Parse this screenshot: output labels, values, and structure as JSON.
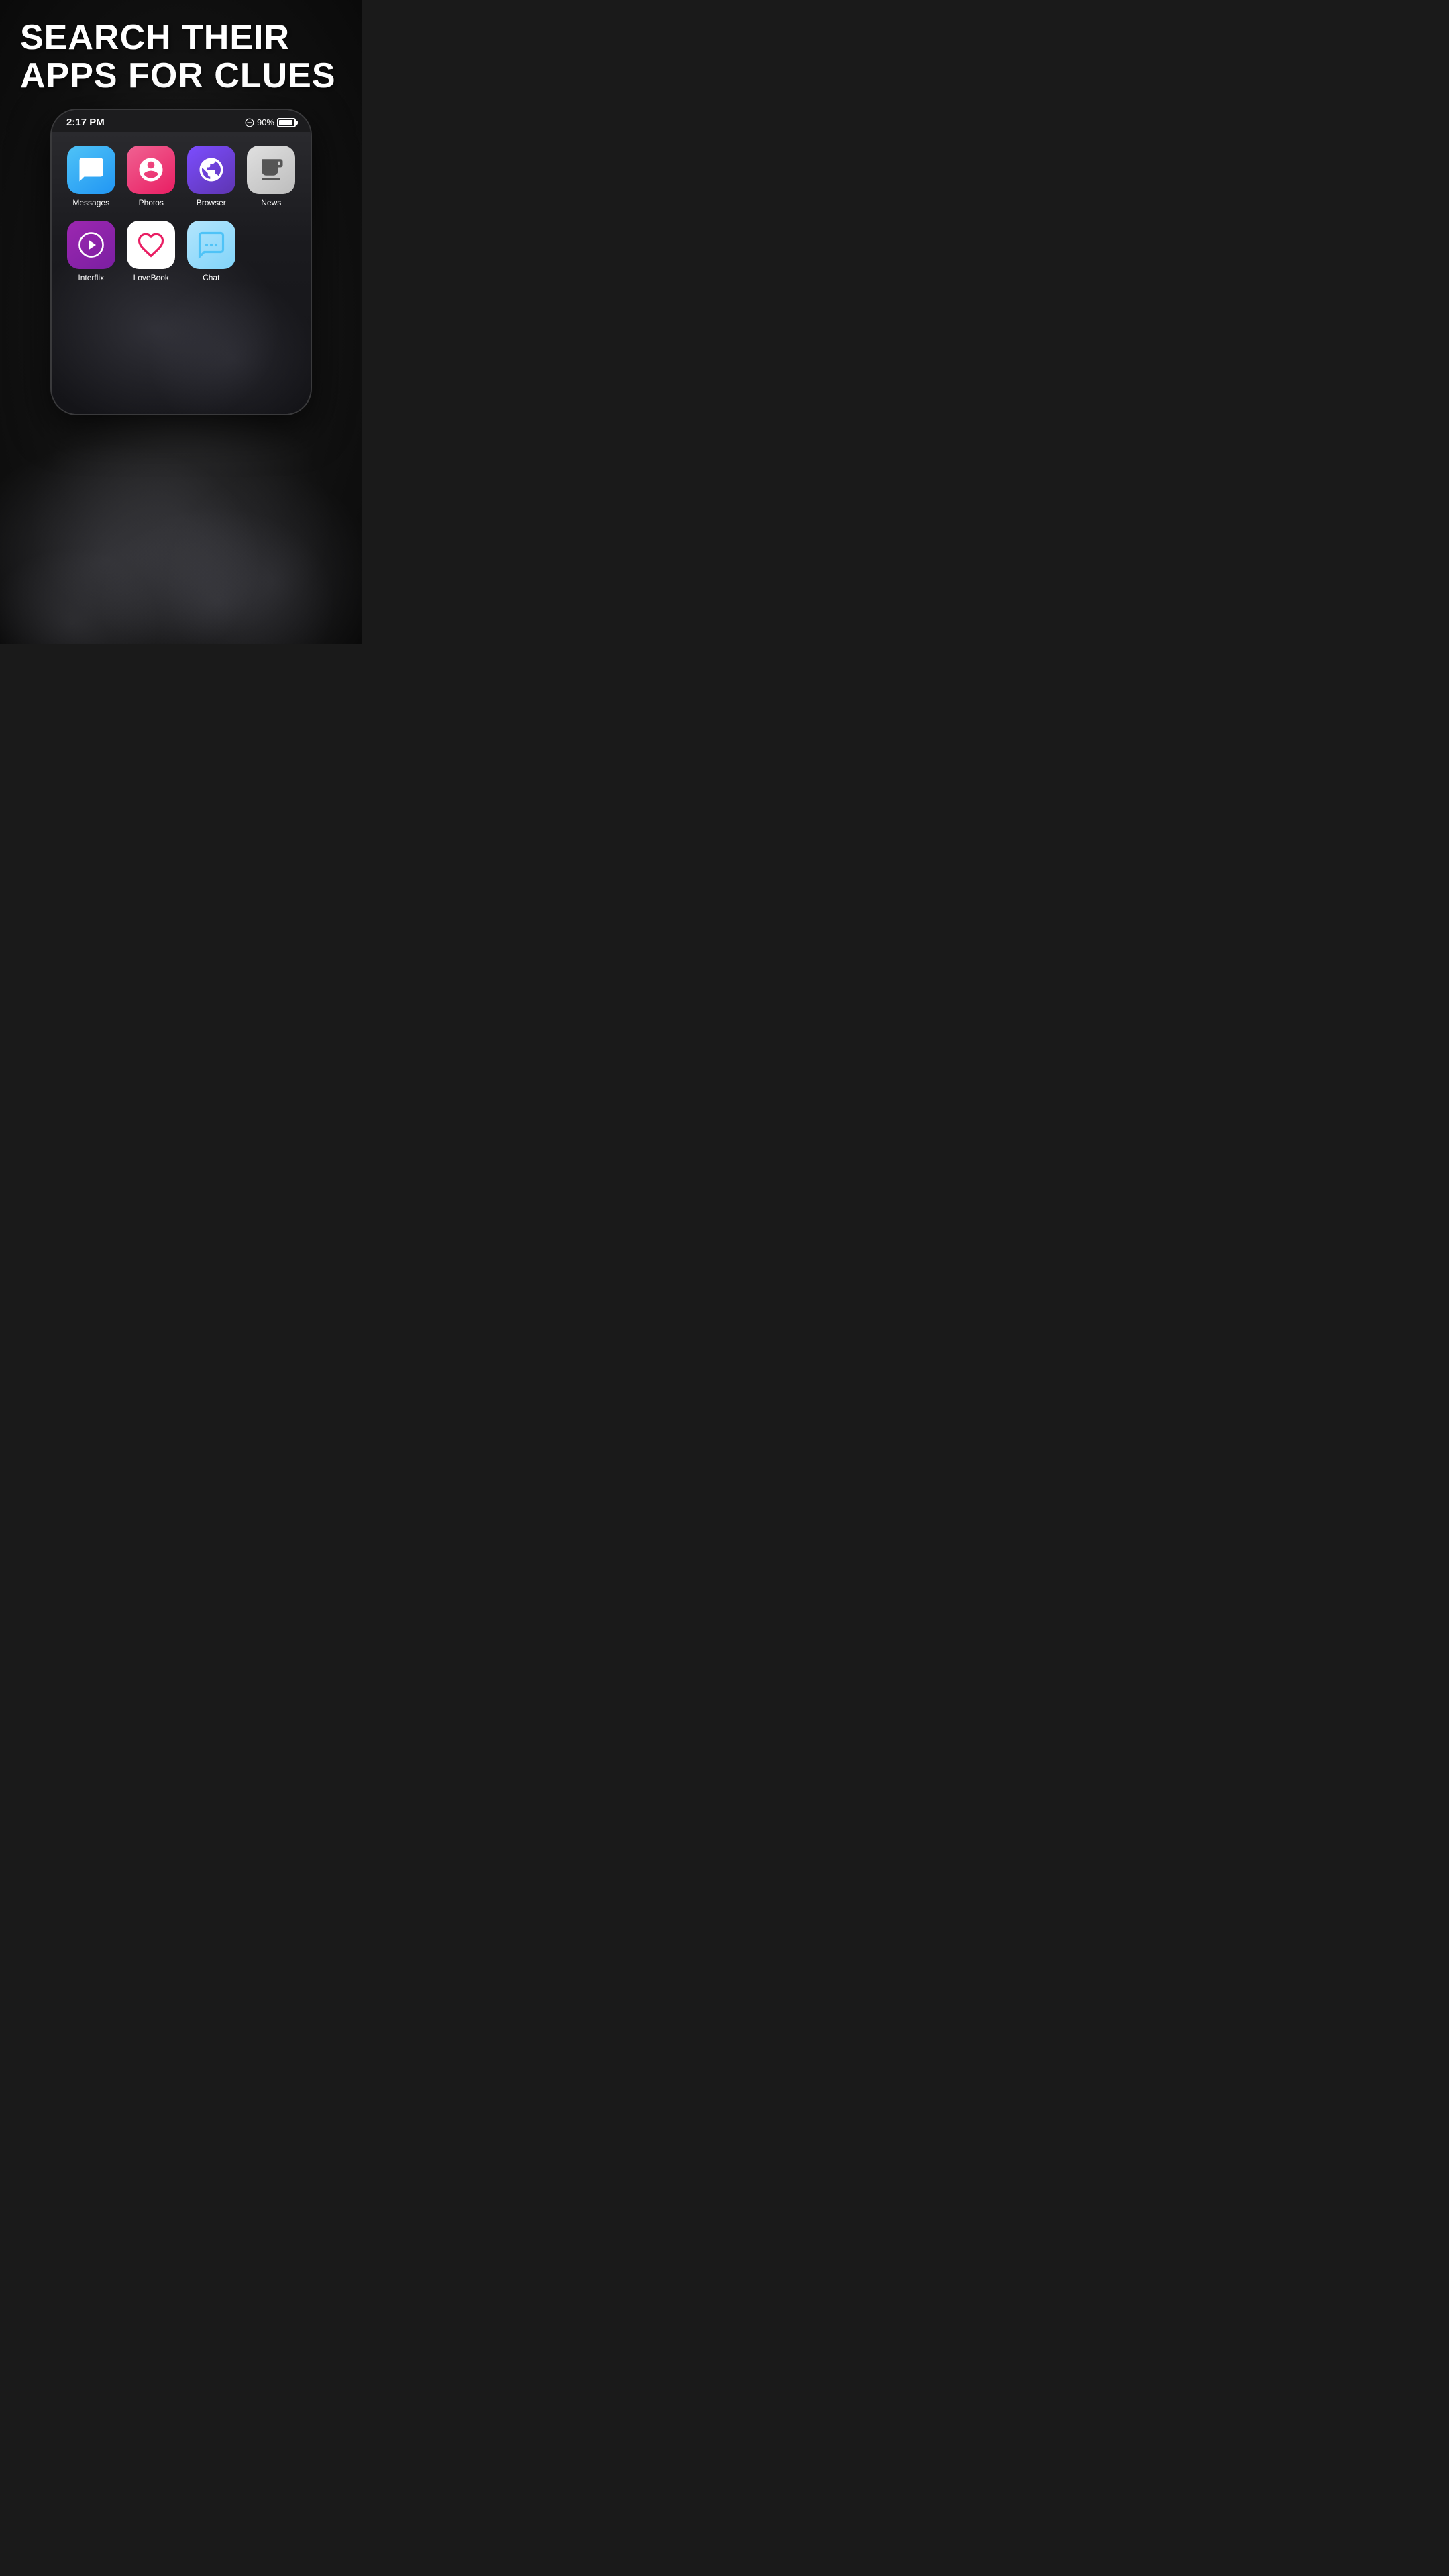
{
  "page": {
    "headline_line1": "SEARCH THEIR",
    "headline_line2": "APPS FOR CLUES"
  },
  "status_bar": {
    "time": "2:17 PM",
    "battery_percent": "90%"
  },
  "apps_row1": [
    {
      "id": "messages",
      "label": "Messages",
      "icon_type": "messages"
    },
    {
      "id": "photos",
      "label": "Photos",
      "icon_type": "photos"
    },
    {
      "id": "browser",
      "label": "Browser",
      "icon_type": "browser"
    },
    {
      "id": "news",
      "label": "News",
      "icon_type": "news"
    }
  ],
  "apps_row2": [
    {
      "id": "interflix",
      "label": "Interflix",
      "icon_type": "interflix"
    },
    {
      "id": "lovebook",
      "label": "LoveBook",
      "icon_type": "lovebook"
    },
    {
      "id": "chat",
      "label": "Chat",
      "icon_type": "chat"
    }
  ]
}
